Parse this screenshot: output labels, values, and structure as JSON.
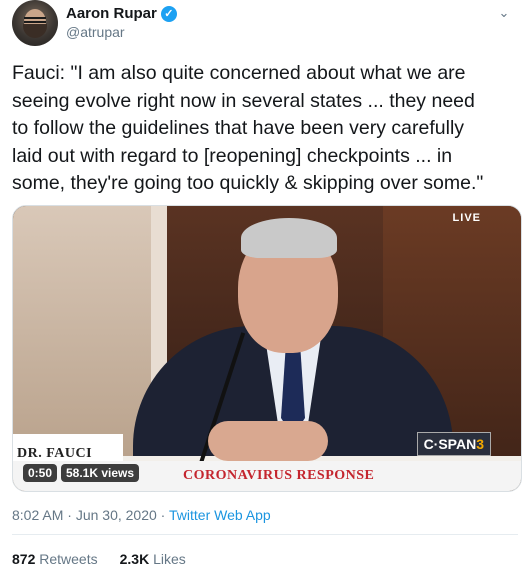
{
  "author": {
    "name": "Aaron Rupar",
    "handle": "@atrupar",
    "verified_icon": "check"
  },
  "tweet": {
    "text": "Fauci: \"I am also quite concerned about what we are\nseeing evolve right now in several states ... they need\nto follow the guidelines that have been very carefully\nlaid out with regard to [reopening] checkpoints ... in\nsome, they're going too quickly & skipping over some.\""
  },
  "video": {
    "live_label": "LIVE",
    "nameplate": "DR. FAUCI",
    "network_main": "C·SPAN",
    "network_number": "3",
    "banner": "CORONAVIRUS RESPONSE",
    "time": "0:50",
    "views": "58.1K views"
  },
  "meta": {
    "time": "8:02 AM",
    "sep1": " · ",
    "date": "Jun 30, 2020",
    "sep2": " · ",
    "app": "Twitter Web App"
  },
  "stats": {
    "retweets_count": "872",
    "retweets_label": "Retweets",
    "likes_count": "2.3K",
    "likes_label": "Likes"
  },
  "colors": {
    "link": "#1b95e0",
    "verified": "#1da1f2",
    "banner_red": "#c4252e"
  }
}
